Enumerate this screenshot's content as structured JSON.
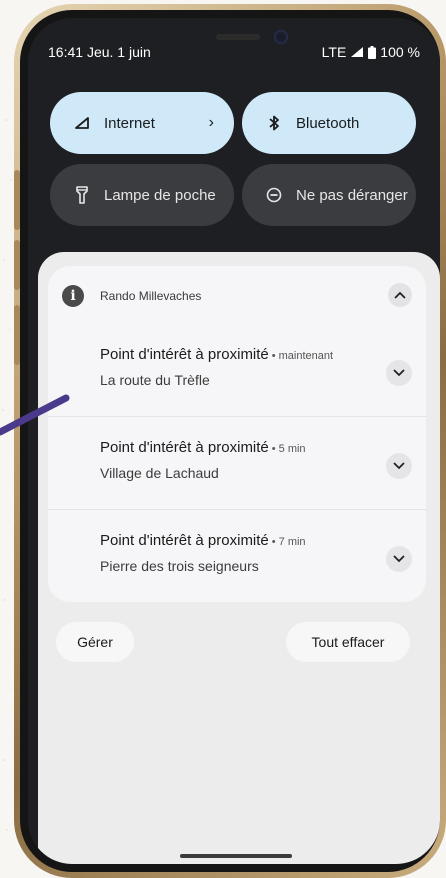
{
  "status_bar": {
    "time": "16:41",
    "date": "Jeu. 1 juin",
    "network": "LTE",
    "battery": "100 %"
  },
  "quick_settings": {
    "tiles": [
      {
        "label": "Internet",
        "icon": "signal-icon",
        "state": "on",
        "has_chevron": true
      },
      {
        "label": "Bluetooth",
        "icon": "bluetooth-icon",
        "state": "on"
      },
      {
        "label": "Lampe de poche",
        "icon": "flashlight-icon",
        "state": "off"
      },
      {
        "label": "Ne pas déranger",
        "icon": "do-not-disturb-icon",
        "state": "off"
      }
    ]
  },
  "notifications": {
    "app_name": "Rando Millevaches",
    "app_icon": "info-icon",
    "items": [
      {
        "title": "Point d'intérêt à proximité",
        "time": "maintenant",
        "text": "La route du Trèfle"
      },
      {
        "title": "Point d'intérêt à proximité",
        "time": "5 min",
        "text": "Village de Lachaud"
      },
      {
        "title": "Point d'intérêt à proximité",
        "time": "7 min",
        "text": "Pierre des trois seigneurs"
      }
    ],
    "separator": "•"
  },
  "actions": {
    "manage_label": "Gérer",
    "clear_all_label": "Tout effacer"
  },
  "colors": {
    "tile_on": "#cfe9f9",
    "tile_off": "#3b3c40",
    "accent_stroke": "#4b3a8c"
  }
}
